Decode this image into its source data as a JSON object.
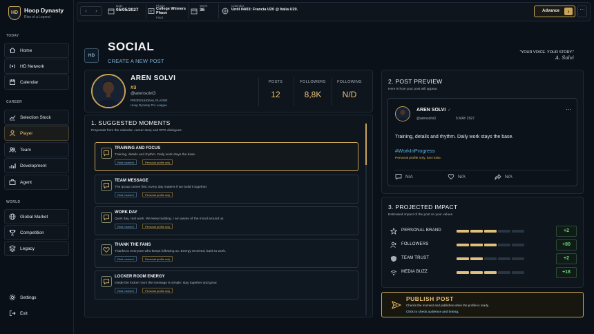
{
  "brand": {
    "name": "Hoop Dynasty",
    "tagline": "Rise of a Legend",
    "logo": "HD"
  },
  "sidebar": {
    "sections": [
      {
        "label": "TODAY",
        "items": [
          {
            "label": "Home",
            "icon": "home-icon"
          },
          {
            "label": "HD Network",
            "icon": "broadcast-icon"
          },
          {
            "label": "Calendar",
            "icon": "calendar-icon"
          }
        ]
      },
      {
        "label": "CAREER",
        "items": [
          {
            "label": "Selection Stock",
            "icon": "trend-icon"
          },
          {
            "label": "Player",
            "icon": "user-icon",
            "active": true
          },
          {
            "label": "Team",
            "icon": "team-icon"
          },
          {
            "label": "Development",
            "icon": "chart-icon"
          },
          {
            "label": "Agent",
            "icon": "briefcase-icon"
          }
        ]
      },
      {
        "label": "WORLD",
        "items": [
          {
            "label": "Global Market",
            "icon": "globe-icon"
          },
          {
            "label": "Competition",
            "icon": "trophy-icon"
          },
          {
            "label": "Legacy",
            "icon": "stack-icon"
          }
        ]
      }
    ],
    "footer": [
      {
        "label": "Settings",
        "icon": "gear-icon"
      },
      {
        "label": "Exit",
        "icon": "exit-icon"
      }
    ]
  },
  "topbar": {
    "date_label": "Date",
    "date_value": "05/05/2027",
    "phase_label": "Phase",
    "phase_value_1": "College Winners",
    "phase_value_2": "Phase",
    "phase_sub": "Final",
    "week_label": "Week",
    "week_value": "36",
    "calendar_label": "Calendar",
    "calendar_value": "Until 04/03: Francia U20 @ Italia U20.",
    "advance_label": "Advance"
  },
  "header": {
    "badge": "HD",
    "title": "SOCIAL",
    "subtitle": "CREATE A NEW POST",
    "quote": "\"YOUR VOICE. YOUR STORY.\"",
    "signature": "A. Solvi"
  },
  "profile": {
    "name": "AREN SOLVI",
    "number": "#3",
    "handle": "@arensolvi3",
    "role": "PROFESSIONAL PLAYER",
    "team": "Hoop Dynasty Pro League",
    "stats": [
      {
        "label": "POSTS",
        "value": "12"
      },
      {
        "label": "FOLLOWERS",
        "value": "8,8K"
      },
      {
        "label": "FOLLOWING",
        "value": "N/D"
      }
    ]
  },
  "moments": {
    "title": "1. SUGGESTED MOMENTS",
    "subtitle": "Proposals from the calendar, career story and RPG dialogues.",
    "tag_real": "Real moment",
    "tag_personal": "Personal profile only",
    "items": [
      {
        "title": "TRAINING AND FOCUS",
        "desc": "Training, details and rhythm. Daily work stays the base.",
        "icon": "chat-icon"
      },
      {
        "title": "TEAM MESSAGE",
        "desc": "The group comes first. Every day matters if we build it together.",
        "icon": "chat-icon"
      },
      {
        "title": "WORK DAY",
        "desc": "Quiet day, real work. We keep building. I am aware of the mood around us.",
        "icon": "chat-icon"
      },
      {
        "title": "THANK THE FANS",
        "desc": "Thanks to everyone who keeps following us. Energy received, back to work.",
        "icon": "heart-icon"
      },
      {
        "title": "LOCKER ROOM ENERGY",
        "desc": "Inside the locker room the message is simple: stay together and grow.",
        "icon": "chat-icon"
      }
    ]
  },
  "preview": {
    "title": "2. POST PREVIEW",
    "subtitle": "Here is how your post will appear.",
    "name": "AREN SOLVI",
    "verified": "✓",
    "handle": "@arensolvi3",
    "date": "5 MAY 2027",
    "text": "Training, details and rhythm. Daily work stays the base.",
    "hashtag": "#WorkInProgress",
    "note": "Personal profile only, low noise.",
    "comments": "N/A",
    "likes": "N/A",
    "shares": "N/A"
  },
  "impact": {
    "title": "3. PROJECTED IMPACT",
    "subtitle": "Estimated impact of the post on your values.",
    "rows": [
      {
        "label": "PERSONAL BRAND",
        "value": "+2",
        "level": 0.6,
        "icon": "star-icon"
      },
      {
        "label": "FOLLOWERS",
        "value": "+80",
        "level": 0.6,
        "icon": "followers-icon"
      },
      {
        "label": "TEAM TRUST",
        "value": "+2",
        "level": 0.4,
        "icon": "shield-icon"
      },
      {
        "label": "MEDIA BUZZ",
        "value": "+18",
        "level": 0.6,
        "icon": "signal-icon"
      }
    ]
  },
  "publish": {
    "title": "PUBLISH POST",
    "subtitle": "Checks the moment and publishes when the profile is ready.",
    "hint": "Click to check audience and timing."
  },
  "colors": {
    "accent": "#c9a55a",
    "link": "#5faee3",
    "positive": "#67d47a"
  }
}
